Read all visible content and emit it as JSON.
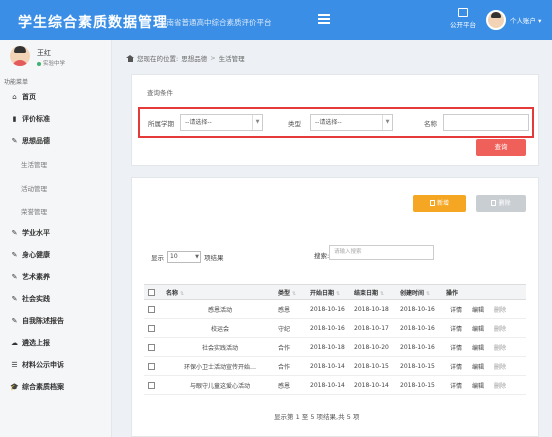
{
  "header": {
    "title": "学生综合素质数据管理",
    "subtitle": "河南省普通高中综合素质评价平台",
    "public_platform": "公开平台",
    "user_menu": "个人账户 ▾"
  },
  "sidebar": {
    "user_name": "王红",
    "user_status": "实验中学",
    "menu_header": "功能菜单",
    "items": [
      {
        "icon": "home-icon",
        "glyph": "⌂",
        "label": "首页"
      },
      {
        "icon": "book-icon",
        "glyph": "▮",
        "label": "评价标准"
      },
      {
        "icon": "edit-icon",
        "glyph": "✎",
        "label": "思想品德"
      },
      {
        "icon": "edit-icon",
        "glyph": "✎",
        "label": "学业水平"
      },
      {
        "icon": "edit-icon",
        "glyph": "✎",
        "label": "身心健康"
      },
      {
        "icon": "edit-icon",
        "glyph": "✎",
        "label": "艺术素养"
      },
      {
        "icon": "edit-icon",
        "glyph": "✎",
        "label": "社会实践"
      },
      {
        "icon": "edit-icon",
        "glyph": "✎",
        "label": "自我陈述报告"
      },
      {
        "icon": "cloud-upload-icon",
        "glyph": "☁",
        "label": "遴选上报"
      },
      {
        "icon": "list-icon",
        "glyph": "☰",
        "label": "材料公示申诉"
      },
      {
        "icon": "graduation-cap-icon",
        "glyph": "🎓",
        "label": "综合素质档案"
      }
    ],
    "sub_items": [
      "生活管理",
      "活动管理",
      "荣誉管理"
    ]
  },
  "breadcrumb": {
    "prefix": "您现在的位置:",
    "level1": "思想品德",
    "level2": "生活管理"
  },
  "query": {
    "title": "查询条件",
    "semester_label": "所属学期",
    "semester_value": "--请选择--",
    "type_label": "类型",
    "type_value": "--请选择--",
    "name_label": "名称",
    "name_value": "",
    "button": "查询"
  },
  "actions": {
    "add": "新增",
    "delete": "删除"
  },
  "table_controls": {
    "show_prefix": "显示",
    "page_size": "10",
    "show_suffix": "项结果",
    "search_label": "搜索:",
    "search_placeholder": "请输入搜索"
  },
  "table": {
    "headers": [
      "名称",
      "类型",
      "开始日期",
      "结束日期",
      "创建时间",
      "操作"
    ],
    "rows": [
      {
        "name": "感恩活动",
        "type": "感恩",
        "start": "2018-10-16",
        "end": "2018-10-18",
        "created": "2018-10-16"
      },
      {
        "name": "校运会",
        "type": "守纪",
        "start": "2018-10-16",
        "end": "2018-10-17",
        "created": "2018-10-16"
      },
      {
        "name": "社会实践活动",
        "type": "合作",
        "start": "2018-10-18",
        "end": "2018-10-20",
        "created": "2018-10-16"
      },
      {
        "name": "环保小卫士活动宣传开始…",
        "type": "合作",
        "start": "2018-10-14",
        "end": "2018-10-15",
        "created": "2018-10-15"
      },
      {
        "name": "与眼守儿童这爱心活动",
        "type": "感恩",
        "start": "2018-10-14",
        "end": "2018-10-14",
        "created": "2018-10-15"
      }
    ],
    "row_actions": [
      "详情",
      "编辑",
      "删除"
    ]
  },
  "pager": {
    "info": "显示第 1 至 5 项结果,共 5 项"
  },
  "colors": {
    "header_bg": "#3a8ee6",
    "query_button": "#f0605a",
    "add_button": "#f5a623",
    "highlight_border": "#e43a3a"
  }
}
